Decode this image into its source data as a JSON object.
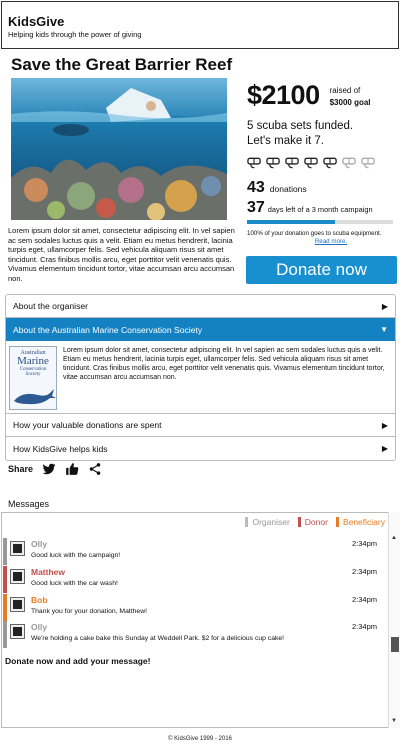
{
  "header": {
    "brand": "KidsGive",
    "tagline": "Helping kids through the power of giving"
  },
  "campaign": {
    "title": "Save the Great Barrier Reef",
    "description": "Lorem ipsum dolor sit amet, consectetur adipiscing elit. In vel sapien ac sem sodales luctus quis a velit. Etiam eu metus hendrerit, lacinia turpis eget, ullamcorper felis. Sed vehicula aliquam risus sit amet tincidunt. Cras finibus mollis arcu, eget porttitor velit venenatis quis. Vivamus elementum tincidunt tortor, vitae accumsan arcu accumsan non."
  },
  "stats": {
    "amount": "$2100",
    "raised_of": "raised of",
    "goal": "$3000 goal",
    "funded_line1": "5 scuba sets funded.",
    "funded_line2": "Let's make it 7.",
    "snorkels_total": 7,
    "snorkels_funded": 5,
    "donations_count": "43",
    "donations_label": "donations",
    "days_left": "37",
    "days_label": "days left of a 3 month campaign",
    "days_progress_fraction": 0.6,
    "note": "100% of your donation goes to scuba equipment.",
    "read_more": "Read more."
  },
  "donate_button": "Donate now",
  "accordion": {
    "items": [
      {
        "label": "About the organiser",
        "arrow": "▶"
      },
      {
        "label": "About the Australian Marine Conservation Society",
        "arrow": "▼"
      },
      {
        "label": "How your valuable donations are spent",
        "arrow": "▶"
      },
      {
        "label": "How KidsGive helps kids",
        "arrow": "▶"
      }
    ],
    "org_body": "Lorem ipsum dolor sit amet, consectetur adipiscing elit. In vel sapien ac sem sodales luctus quis a velit. Etiam eu metus hendrerit, lacinia turpis eget, ullamcorper felis. Sed vehicula aliquam risus sit amet tincidunt. Cras finibus mollis arcu, eget porttitor velit venenatis quis. Vivamus elementum tincidunt tortor, vitae accumsan arcu accumsan non.",
    "logo": {
      "line1": "Australian",
      "line2": "Marine",
      "line3": "Conservation",
      "line4": "Society"
    }
  },
  "share": {
    "label": "Share",
    "icons": [
      "twitter-icon",
      "thumbs-up-icon",
      "share-icon"
    ]
  },
  "messages": {
    "title": "Messages",
    "legend": [
      {
        "label": "Organiser",
        "color": "#bbbbbb"
      },
      {
        "label": "Donor",
        "color": "#c0504d"
      },
      {
        "label": "Beneficiary",
        "color": "#e97c22"
      }
    ],
    "items": [
      {
        "name": "Olly",
        "role_color": "#999999",
        "time": "2:34pm",
        "text": "Good luck with the campaign!"
      },
      {
        "name": "Matthew",
        "role_color": "#c0504d",
        "time": "2:34pm",
        "text": "Good luck with the car wash!"
      },
      {
        "name": "Bob",
        "role_color": "#e97c22",
        "time": "2:34pm",
        "text": "Thank you for your donation, Matthew!"
      },
      {
        "name": "Olly",
        "role_color": "#999999",
        "time": "2:34pm",
        "text": "We're holding a cake bake this Sunday at Weddell Park. $2 for a delicious cup cake!"
      }
    ],
    "compose": "Donate now and add your message!"
  },
  "footer": "© KidsGive 1999 - 2016",
  "colors": {
    "accent": "#1890cf",
    "active_header": "#1482c2"
  }
}
